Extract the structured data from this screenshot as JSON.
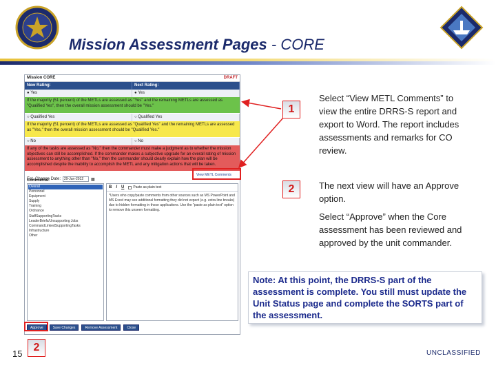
{
  "slide": {
    "title_main": "Mission Assessment Pages",
    "title_sep": " - ",
    "title_sub": "CORE",
    "page_number": "15",
    "classification": "UNCLASSIFIED"
  },
  "colors": {
    "title": "#1b2a6b",
    "highlight": "#e02020",
    "note_text": "#1b2a8c",
    "band_green": "#6cc24a",
    "band_yellow": "#f7e84b",
    "band_red": "#e35b5b"
  },
  "icons": {
    "left_logo": "navy-seal-icon",
    "right_logo": "navy-command-crest-icon"
  },
  "screenshot": {
    "mission_name": "Mission CORE",
    "draft_label": "DRAFT",
    "new_rating_label": "New Rating:",
    "next_rating_label": "Next Rating:",
    "new_rating_value": "Yes",
    "next_rating_value": "Yes",
    "band_green_text": "If the majority (51 percent) of the METLs are assessed as \"Yes\" and the remaining METLs are assessed as \"Qualified Yes\", then the overall mission assessment should be \"Yes.\"",
    "option_qualified_yes": "Qualified Yes",
    "option_qualified_yes_2": "Qualified Yes",
    "band_yellow_text": "If the majority (51 percent) of the METLs are assessed as \"Qualified Yes\" and the remaining METLs are assessed as \"Yes,\" then the overall mission assessment should be \"Qualified Yes.\"",
    "option_no": "No",
    "option_no_2": "No",
    "band_red_text": "If any of the tasks are assessed as \"No,\" then the commander must make a judgment as to whether the mission objectives can still be accomplished. If the commander makes a subjective upgrade for an overall rating of mission assessment to anything other than \"No,\" then the commander should clearly explain how the plan will be accomplished despite the inability to accomplish the METL and any mitigation actions that will be taken.",
    "est_change_date_label": "Est. Change Date:",
    "est_change_date_value": "29-Jun-2012",
    "view_metl_comments_link": "View METL Comments",
    "comments_label": "Comments:",
    "categories": [
      "Overall",
      "Personnel",
      "Equipment",
      "Supply",
      "Training",
      "Ordnance",
      "StaffSupportingTasks",
      "LeaderBriefs/Unsupporting Jobs",
      "CommandLinkedSupportingTasks",
      "Infrastructure",
      "Other"
    ],
    "editor_bold": "B",
    "editor_italic": "I",
    "editor_underline": "U",
    "paste_plain_label": "Paste as plain text",
    "editor_text": "*Users who copy/paste comments from other sources such as MS PowerPoint and MS Excel may see additional formatting they did not expect (e.g. extra line breaks) due to hidden formatting in those applications. Use the \"paste as plain text\" option to remove this unseen formatting.",
    "buttons": {
      "approve": "Approve",
      "save_changes": "Save Changes",
      "remove_assessment": "Remove Assessment",
      "close": "Close"
    }
  },
  "markers": {
    "one": "1",
    "two": "2",
    "two_bottom": "2"
  },
  "steps": {
    "step1": "Select “View METL Comments” to view the entire DRRS-S report and export to Word. The report includes assessments and remarks for CO review.",
    "step2a": "The next view will have an Approve option.",
    "step2b": "Select “Approve” when the Core assessment has been reviewed and approved by the unit commander."
  },
  "note": "Note: At this point, the DRRS-S part of the assessment is complete. You still must update the Unit Status page and complete the SORTS part of the assessment."
}
